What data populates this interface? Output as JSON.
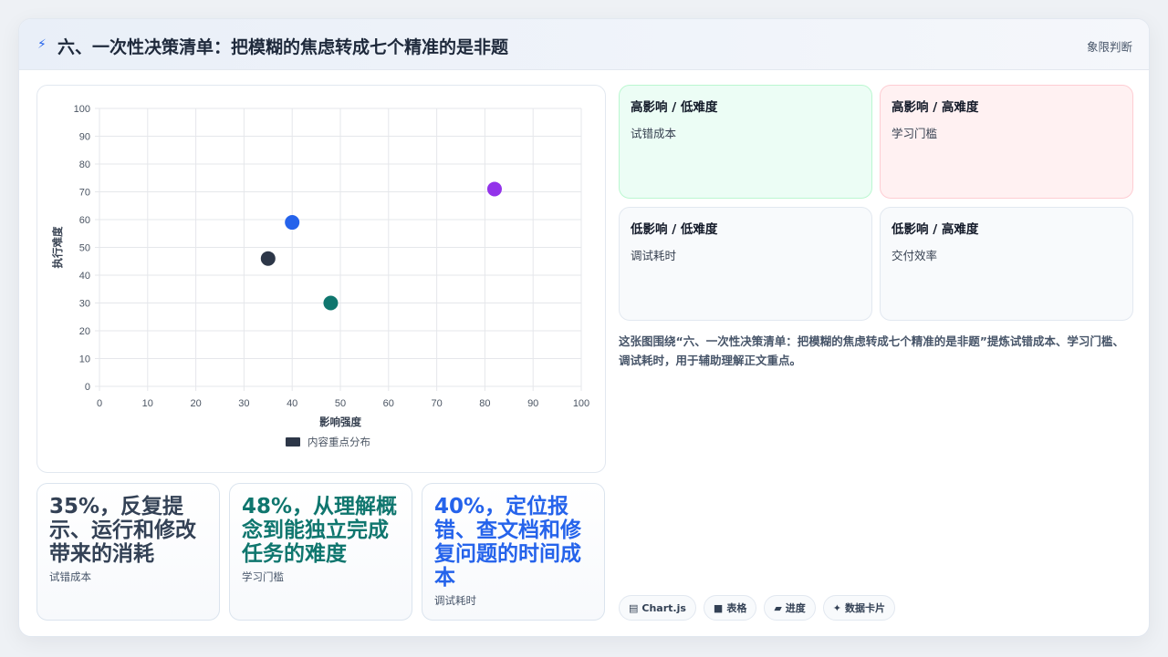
{
  "header": {
    "icon": "bolt-icon",
    "title": "六、一次性决策清单：把模糊的焦虑转成七个精准的是非题",
    "tag": "象限判断"
  },
  "chart_data": {
    "type": "scatter",
    "xlabel": "影响强度",
    "ylabel": "执行难度",
    "xlim": [
      0,
      100
    ],
    "ylim": [
      0,
      100
    ],
    "xticks": [
      "0",
      "10",
      "20",
      "30",
      "40",
      "50",
      "60",
      "70",
      "80",
      "90",
      "100"
    ],
    "yticks": [
      "0",
      "10",
      "20",
      "30",
      "40",
      "50",
      "60",
      "70",
      "80",
      "90",
      "100"
    ],
    "grid": true,
    "legend": {
      "label": "内容重点分布",
      "placement": "bottom"
    },
    "points": [
      {
        "x": 35,
        "y": 46,
        "color": "#2d3748"
      },
      {
        "x": 40,
        "y": 59,
        "color": "#2563eb"
      },
      {
        "x": 48,
        "y": 30,
        "color": "#0f766e"
      },
      {
        "x": 82,
        "y": 71,
        "color": "#9333ea"
      }
    ]
  },
  "stats": [
    {
      "value": "35%，反复提示、运行和修改带来的消耗",
      "label": "试错成本",
      "color": "#334155"
    },
    {
      "value": "48%，从理解概念到能独立完成任务的难度",
      "label": "学习门槛",
      "color": "#0f766e"
    },
    {
      "value": "40%，定位报错、查文档和修复问题的时间成本",
      "label": "调试耗时",
      "color": "#2563eb"
    }
  ],
  "quadrants": [
    {
      "title": "高影响 / 低难度",
      "item": "试错成本",
      "bg": "#ecfdf5",
      "border": "#bbf7d0"
    },
    {
      "title": "高影响 / 高难度",
      "item": "学习门槛",
      "bg": "#fff1f2",
      "border": "#fecdd3"
    },
    {
      "title": "低影响 / 低难度",
      "item": "调试耗时",
      "bg": "#f8fafc",
      "border": "#e2e8f0"
    },
    {
      "title": "低影响 / 高难度",
      "item": "交付效率",
      "bg": "#f8fafc",
      "border": "#e2e8f0"
    }
  ],
  "caption": "这张图围绕“六、一次性决策清单：把模糊的焦虑转成七个精准的是非题”提炼试错成本、学习门槛、调试耗时，用于辅助理解正文重点。",
  "pills": [
    {
      "icon": "chart-icon",
      "glyph": "▤",
      "label": "Chart.js"
    },
    {
      "icon": "table-icon",
      "glyph": "■",
      "label": "表格"
    },
    {
      "icon": "progress-icon",
      "glyph": "▰",
      "label": "进度"
    },
    {
      "icon": "sparkle-icon",
      "glyph": "✦",
      "label": "数据卡片"
    }
  ]
}
